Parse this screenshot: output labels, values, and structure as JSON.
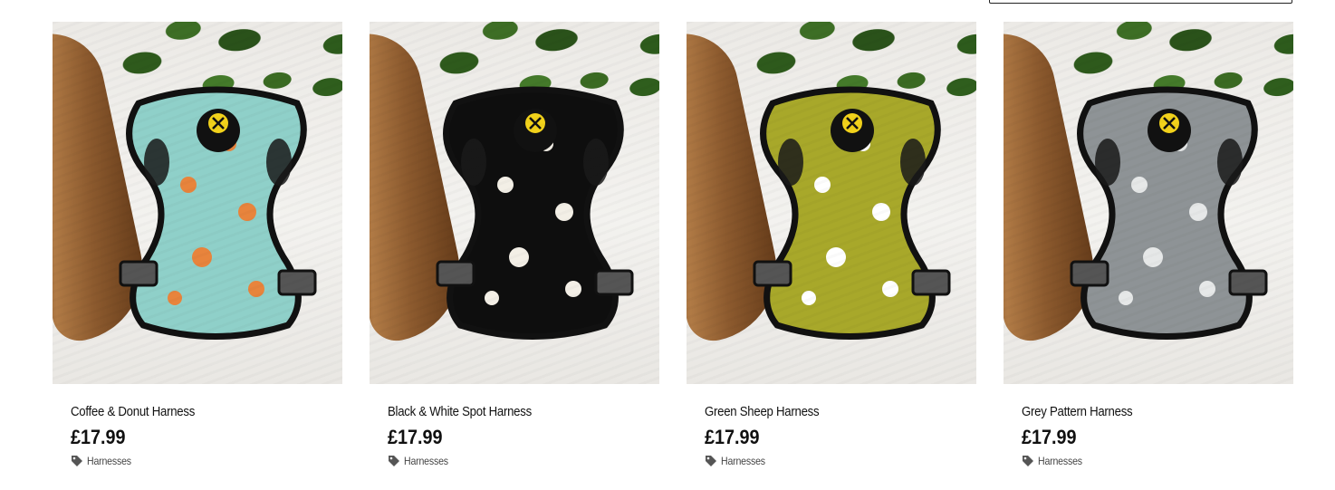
{
  "products": [
    {
      "name": "Coffee & Donut Harness",
      "price": "£17.99",
      "category": "Harnesses",
      "pattern_color": "#8fd0c9",
      "pattern_accent": "#e8843c",
      "icon": "tag-icon"
    },
    {
      "name": "Black & White Spot Harness",
      "price": "£17.99",
      "category": "Harnesses",
      "pattern_color": "#0e0e0e",
      "pattern_accent": "#f3efe6",
      "icon": "tag-icon"
    },
    {
      "name": "Green Sheep Harness",
      "price": "£17.99",
      "category": "Harnesses",
      "pattern_color": "#a8a82a",
      "pattern_accent": "#ffffff",
      "icon": "tag-icon"
    },
    {
      "name": "Grey Pattern Harness",
      "price": "£17.99",
      "category": "Harnesses",
      "pattern_color": "#8e9396",
      "pattern_accent": "#e6e8e8",
      "icon": "tag-icon"
    }
  ],
  "brand_badge": {
    "color": "#f2d21b"
  }
}
